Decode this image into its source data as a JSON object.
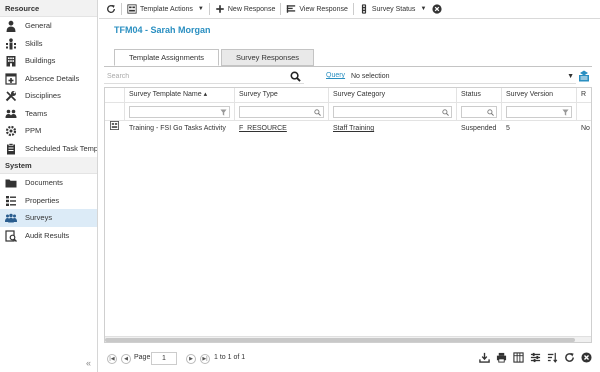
{
  "sidebar": {
    "sections": [
      {
        "title": "Resource",
        "items": [
          {
            "label": "General",
            "icon": "person-icon"
          },
          {
            "label": "Skills",
            "icon": "skills-icon"
          },
          {
            "label": "Buildings",
            "icon": "building-icon"
          },
          {
            "label": "Absence Details",
            "icon": "absence-icon"
          },
          {
            "label": "Disciplines",
            "icon": "tools-icon"
          },
          {
            "label": "Teams",
            "icon": "team-icon"
          },
          {
            "label": "PPM",
            "icon": "ppm-icon"
          },
          {
            "label": "Scheduled Task Templates",
            "icon": "task-template-icon"
          }
        ]
      },
      {
        "title": "System",
        "items": [
          {
            "label": "Documents",
            "icon": "folder-icon"
          },
          {
            "label": "Properties",
            "icon": "properties-icon"
          },
          {
            "label": "Surveys",
            "icon": "surveys-icon",
            "active": true
          },
          {
            "label": "Audit Results",
            "icon": "audit-icon"
          }
        ]
      }
    ],
    "collapse_label": "«"
  },
  "toolbar": {
    "template_actions": "Template Actions",
    "new_response": "New Response",
    "view_response": "View Response",
    "survey_status": "Survey Status"
  },
  "page_title": "TFM04 - Sarah Morgan",
  "tabs": [
    {
      "label": "Template Assignments",
      "active": true
    },
    {
      "label": "Survey Responses",
      "active": false
    }
  ],
  "search": {
    "placeholder": "Search",
    "query_link": "Query",
    "selection_value": "No selection"
  },
  "grid": {
    "columns": [
      "Survey Template Name",
      "Survey Type",
      "Survey Category",
      "Status",
      "Survey Version",
      "R"
    ],
    "sort_indicator": "▴",
    "rows": [
      [
        "Training - FSI Go Tasks Activity",
        "F_RESOURCE",
        "Staff Training",
        "Suspended",
        "5",
        "No"
      ]
    ]
  },
  "pager": {
    "page_label": "Page",
    "page_value": "1",
    "range_text": "1 to 1 of 1"
  },
  "colors": {
    "accent": "#2a8fc1",
    "active_row": "#dcebf7"
  }
}
